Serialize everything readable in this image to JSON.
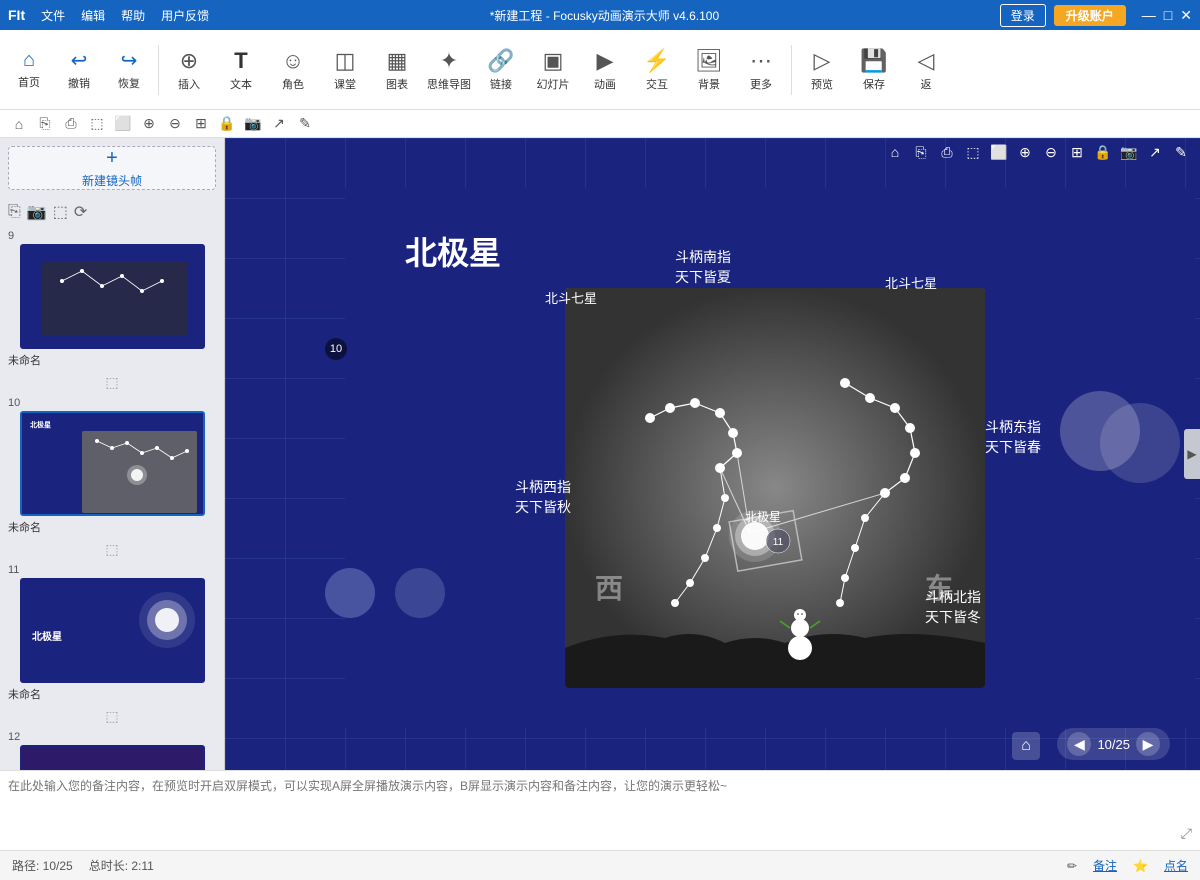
{
  "titlebar": {
    "logo": "FIt",
    "menu": [
      "文件",
      "编辑",
      "帮助",
      "用户反馈"
    ],
    "title": "*新建工程 - Focusky动画演示大师  v4.6.100",
    "login": "登录",
    "upgrade": "升级账户",
    "win_minimize": "—",
    "win_maximize": "□",
    "win_close": "✕"
  },
  "toolbar": {
    "nav_items": [
      {
        "icon": "⌂",
        "label": "首页"
      },
      {
        "icon": "↩",
        "label": "撤销"
      },
      {
        "icon": "↪",
        "label": "恢复"
      }
    ],
    "insert_items": [
      {
        "icon": "⊕",
        "label": "插入"
      },
      {
        "icon": "T",
        "label": "文本"
      },
      {
        "icon": "☺",
        "label": "角色"
      },
      {
        "icon": "◫",
        "label": "课堂"
      },
      {
        "icon": "▦",
        "label": "图表"
      },
      {
        "icon": "✦",
        "label": "思维导图"
      },
      {
        "icon": "🔗",
        "label": "链接"
      },
      {
        "icon": "▣",
        "label": "幻灯片"
      },
      {
        "icon": "▶",
        "label": "动画"
      },
      {
        "icon": "⚡",
        "label": "交互"
      },
      {
        "icon": "🖼",
        "label": "背景"
      },
      {
        "icon": "⋯",
        "label": "更多"
      },
      {
        "icon": "▷",
        "label": "预览"
      },
      {
        "icon": "💾",
        "label": "保存"
      },
      {
        "icon": "◁",
        "label": "返"
      }
    ]
  },
  "secondary_toolbar": {
    "buttons": [
      "⌂",
      "⎘",
      "⎙",
      "⬚",
      "⬜",
      "🔍+",
      "🔍-",
      "⊞",
      "🔒",
      "📷",
      "↗",
      "✎"
    ]
  },
  "slides": [
    {
      "number": "9",
      "label": "未命名",
      "active": false,
      "has_resize": true
    },
    {
      "number": "10",
      "label": "未命名",
      "active": true,
      "has_resize": false
    },
    {
      "number": "11",
      "label": "未命名",
      "active": false,
      "has_resize": true
    },
    {
      "number": "12",
      "label": "",
      "active": false,
      "has_resize": false
    }
  ],
  "new_frame_btn": "新建镜头帧",
  "slide_tools": [
    "⎘",
    "📷",
    "⬚",
    "⟳"
  ],
  "canvas": {
    "title": "北极星",
    "frame_badge_10": "10",
    "frame_badge_11": "11",
    "labels": {
      "top_center": "斗柄南指\n天下皆夏",
      "top_left": "北斗七星",
      "top_right": "北斗七星",
      "right": "斗柄东指\n天下皆春",
      "bottom_right": "斗柄北指\n天下皆冬",
      "bottom_left": "斗柄西指\n天下皆秋",
      "polaris": "北极星",
      "west": "西",
      "east": "东"
    }
  },
  "canvas_nav": {
    "current": "10",
    "total": "25",
    "separator": "/"
  },
  "notes": {
    "placeholder": "在此处输入您的备注内容，在预览时开启双屏模式，可以实现A屏全屏播放演示内容，B屏显示演示内容和备注内容，让您的演示更轻松~"
  },
  "status_bar": {
    "path": "路径: 10/25",
    "duration": "总时长: 2:11",
    "notes_btn": "备注",
    "points_btn": "点名"
  }
}
